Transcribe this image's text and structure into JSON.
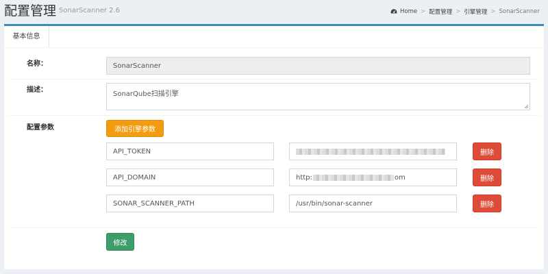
{
  "header": {
    "title": "配置管理",
    "subtitle": "SonarScanner 2.6",
    "breadcrumb": {
      "home": "Home",
      "items": [
        "配置管理",
        "引擎管理"
      ],
      "current": "SonarScanner"
    }
  },
  "tabs": [
    {
      "label": "基本信息",
      "active": true
    }
  ],
  "form": {
    "name_label": "名称：",
    "name_value": "SonarScanner",
    "description_label": "描述：",
    "description_value": "SonarQube扫描引擎",
    "params_label": "配置参数",
    "add_param_button": "添加引擎参数",
    "params": [
      {
        "key": "API_TOKEN",
        "value": "",
        "value_masked": true,
        "delete_label": "删除"
      },
      {
        "key": "API_DOMAIN",
        "value_prefix": "http:",
        "value_suffix": "om",
        "value_masked": true,
        "delete_label": "删除"
      },
      {
        "key": "SONAR_SCANNER_PATH",
        "value": "/usr/bin/sonar-scanner",
        "value_masked": false,
        "delete_label": "删除"
      }
    ],
    "submit_button": "修改"
  },
  "colors": {
    "primary_border": "#3c8dbc",
    "warning": "#f39c12",
    "danger": "#dd4b39",
    "success": "#3d9e6a",
    "background": "#ecf0f5"
  }
}
